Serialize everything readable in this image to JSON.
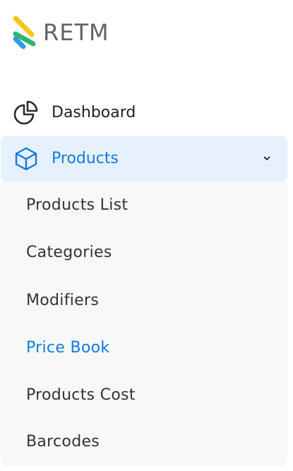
{
  "brand": {
    "logo_text": "RETM",
    "logo_icon": "retm-logo-icon",
    "colors": {
      "stripe_yellow": "#f5c518",
      "stripe_green": "#2fb36e",
      "stripe_blue": "#2f9be6"
    }
  },
  "nav": {
    "dashboard": {
      "label": "Dashboard",
      "icon": "pie-chart-icon"
    },
    "products": {
      "label": "Products",
      "icon": "box-icon",
      "expanded_icon": "chevron-down-icon",
      "submenu": [
        {
          "label": "Products List",
          "active": false
        },
        {
          "label": "Categories",
          "active": false
        },
        {
          "label": "Modifiers",
          "active": false
        },
        {
          "label": "Price Book",
          "active": true
        },
        {
          "label": "Products Cost",
          "active": false
        },
        {
          "label": "Barcodes",
          "active": false
        }
      ]
    }
  },
  "colors": {
    "accent": "#0f7be0",
    "active_bg": "#e6f1fd",
    "submenu_bg": "#f8f8f8",
    "text_primary": "#1f1f1f",
    "text_secondary": "#333333"
  }
}
